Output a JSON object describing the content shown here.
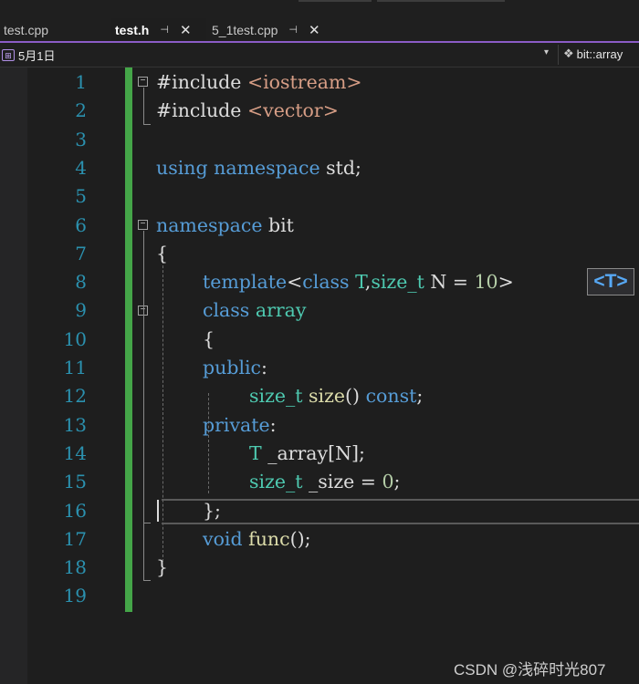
{
  "tabs": [
    {
      "label": "test.cpp",
      "active": false
    },
    {
      "label": "test.h",
      "active": true,
      "pin": "⊣",
      "close": "✕"
    },
    {
      "label": "5_1test.cpp",
      "active": false,
      "pin": "⊣",
      "close": "✕"
    }
  ],
  "nav": {
    "scope": "5月1日",
    "member": "bit::array",
    "dropdown": "▾"
  },
  "line_numbers": [
    "1",
    "2",
    "3",
    "4",
    "5",
    "6",
    "7",
    "8",
    "9",
    "10",
    "11",
    "12",
    "13",
    "14",
    "15",
    "16",
    "17",
    "18",
    "19"
  ],
  "code_lines": [
    [
      {
        "t": "#include ",
        "c": "pl"
      },
      {
        "t": "<iostream>",
        "c": "str"
      }
    ],
    [
      {
        "t": "#include ",
        "c": "pl"
      },
      {
        "t": "<vector>",
        "c": "str"
      }
    ],
    [],
    [
      {
        "t": "using",
        "c": "kw"
      },
      {
        "t": " ",
        "c": "pl"
      },
      {
        "t": "namespace",
        "c": "kw"
      },
      {
        "t": " std;",
        "c": "pl"
      }
    ],
    [],
    [
      {
        "t": "namespace",
        "c": "kw"
      },
      {
        "t": " bit",
        "c": "pl"
      }
    ],
    [
      {
        "t": "{",
        "c": "pl"
      }
    ],
    [
      {
        "t": "template",
        "c": "kw"
      },
      {
        "t": "<",
        "c": "pl"
      },
      {
        "t": "class",
        "c": "kw"
      },
      {
        "t": " ",
        "c": "pl"
      },
      {
        "t": "T",
        "c": "ty"
      },
      {
        "t": ",",
        "c": "pl"
      },
      {
        "t": "size_t",
        "c": "ty"
      },
      {
        "t": " N = ",
        "c": "pl"
      },
      {
        "t": "10",
        "c": "num"
      },
      {
        "t": ">",
        "c": "pl"
      }
    ],
    [
      {
        "t": "class",
        "c": "kw"
      },
      {
        "t": " ",
        "c": "pl"
      },
      {
        "t": "array",
        "c": "ty"
      }
    ],
    [
      {
        "t": "{",
        "c": "pl"
      }
    ],
    [
      {
        "t": "public",
        "c": "kw"
      },
      {
        "t": ":",
        "c": "pl"
      }
    ],
    [
      {
        "t": "size_t",
        "c": "ty"
      },
      {
        "t": " ",
        "c": "pl"
      },
      {
        "t": "size",
        "c": "fn"
      },
      {
        "t": "() ",
        "c": "pl"
      },
      {
        "t": "const",
        "c": "kw"
      },
      {
        "t": ";",
        "c": "pl"
      }
    ],
    [
      {
        "t": "private",
        "c": "kw"
      },
      {
        "t": ":",
        "c": "pl"
      }
    ],
    [
      {
        "t": "T",
        "c": "ty"
      },
      {
        "t": " _array[N];",
        "c": "pl"
      }
    ],
    [
      {
        "t": "size_t",
        "c": "ty"
      },
      {
        "t": " _size = ",
        "c": "pl"
      },
      {
        "t": "0",
        "c": "num"
      },
      {
        "t": ";",
        "c": "pl"
      }
    ],
    [
      {
        "t": "};",
        "c": "pl"
      }
    ],
    [
      {
        "t": "void",
        "c": "kw"
      },
      {
        "t": " ",
        "c": "pl"
      },
      {
        "t": "func",
        "c": "fn"
      },
      {
        "t": "();",
        "c": "pl"
      }
    ],
    [
      {
        "t": "}",
        "c": "pl"
      }
    ],
    []
  ],
  "template_hint": "<T>",
  "fold_markers": [
    "−",
    "−",
    "−"
  ],
  "watermark": "CSDN @浅碎时光807"
}
